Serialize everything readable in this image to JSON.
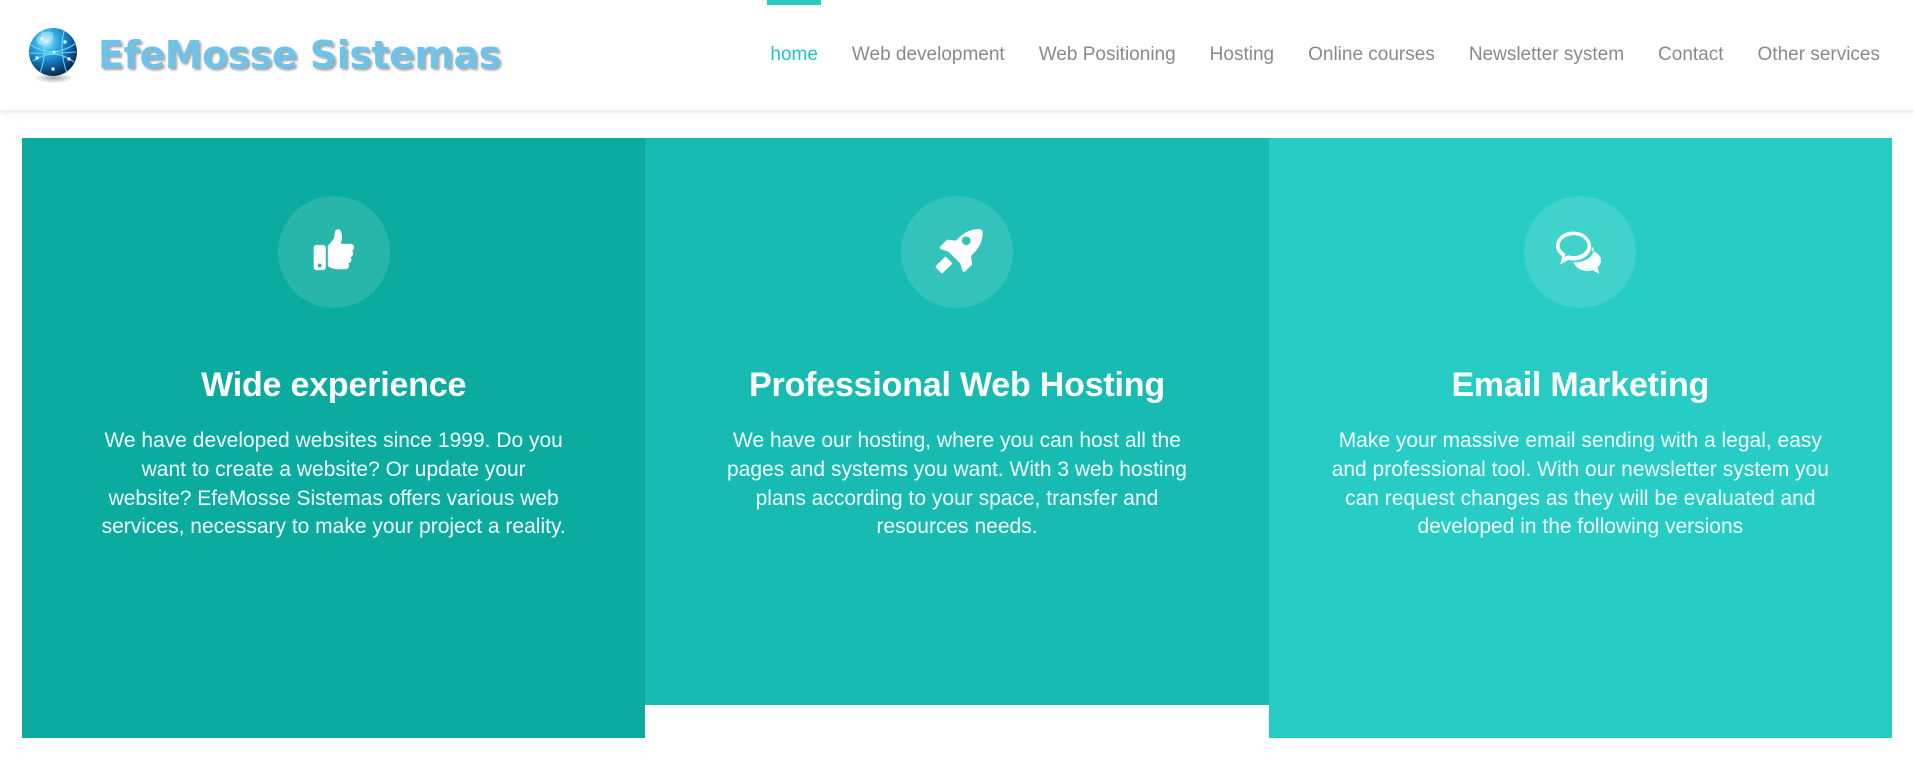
{
  "header": {
    "brand": {
      "name": "EfeMosse Sistemas",
      "logo_icon": "globe-network-icon"
    },
    "nav": {
      "items": [
        {
          "label": "home",
          "active": true
        },
        {
          "label": "Web development",
          "active": false
        },
        {
          "label": "Web Positioning",
          "active": false
        },
        {
          "label": "Hosting",
          "active": false
        },
        {
          "label": "Online courses",
          "active": false
        },
        {
          "label": "Newsletter system",
          "active": false
        },
        {
          "label": "Contact",
          "active": false
        },
        {
          "label": "Other services",
          "active": false
        }
      ]
    }
  },
  "features": {
    "cards": [
      {
        "icon": "thumbs-up-icon",
        "title": "Wide experience",
        "text": "We have developed websites since 1999. Do you want to create a website? Or update your website? EfeMosse Sistemas offers various web services, necessary to make your project a reality.",
        "bg_color": "#0bab9f"
      },
      {
        "icon": "rocket-icon",
        "title": "Professional Web Hosting",
        "text": "We have our hosting, where you can host all the pages and systems you want. With 3 web hosting plans according to your space, transfer and resources needs.",
        "bg_color": "#18bbb2"
      },
      {
        "icon": "chat-bubbles-icon",
        "title": "Email Marketing",
        "text": "Make your massive email sending with a legal, easy and professional tool. With our newsletter system you can request changes as they will be evaluated and developed in the following versions",
        "bg_color": "#27ccc5"
      }
    ]
  },
  "colors": {
    "accent_teal": "#2cc9c0",
    "nav_text": "#8a8a8a",
    "brand_blue": "#6fc3e8",
    "page_background": "#ffffff"
  }
}
